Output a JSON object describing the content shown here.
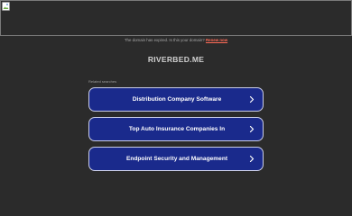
{
  "notice": {
    "text": "The domain has expired. Is this your domain?",
    "renew_link": "Renew now"
  },
  "domain": "RIVERBED.ME",
  "related_label": "Related searches",
  "links": [
    {
      "label": "Distribution Company Software",
      "icon": "chevron-right-icon"
    },
    {
      "label": "Top Auto Insurance Companies In",
      "icon": "chevron-right-icon"
    },
    {
      "label": "Endpoint Security and Management",
      "icon": "chevron-right-icon"
    }
  ],
  "colors": {
    "background": "#2b2b2b",
    "button": "#1a2a8c",
    "renew_link": "#ff6b57"
  }
}
